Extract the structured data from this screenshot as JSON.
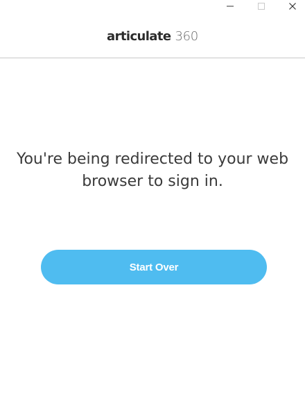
{
  "window": {
    "controls": {
      "minimize_icon": "minimize-icon",
      "maximize_icon": "maximize-icon",
      "close_icon": "close-icon"
    }
  },
  "header": {
    "logo_word": "articulate",
    "logo_number": "360"
  },
  "main": {
    "message": "You're being redirected to your web browser to sign in.",
    "button_label": "Start Over"
  },
  "colors": {
    "accent": "#4fbcf0",
    "text": "#3a3a3a",
    "divider": "#c8c8c8"
  }
}
